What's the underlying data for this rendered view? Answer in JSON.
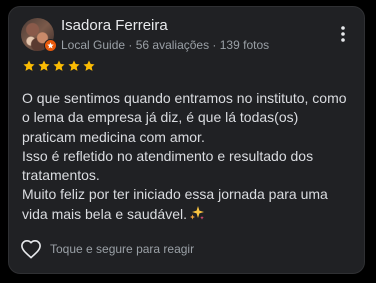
{
  "review": {
    "author": "Isadora Ferreira",
    "author_meta": "Local Guide · 56 avaliações · 139 fotos",
    "rating": 5,
    "rating_max": 5,
    "paragraphs": [
      "O que sentimos quando entramos no instituto, como o lema da empresa já diz, é que lá todas(os) praticam medicina com amor.",
      "Isso é refletido no atendimento e resultado dos tratamentos.",
      "Muito feliz por ter iniciado essa jornada para uma vida mais bela e saudável."
    ],
    "react_label": "Toque e segure para reagir"
  },
  "icons": {
    "more": "more-vert-icon",
    "star": "star-icon",
    "heart": "heart-outline-icon",
    "sparkles": "sparkles-emoji-icon",
    "badge": "local-guide-badge-icon"
  },
  "colors": {
    "card_bg": "#202124",
    "star": "#fbbc04",
    "text_primary": "#e8eaed",
    "text_secondary": "#9aa0a6",
    "badge": "#e8590c"
  }
}
